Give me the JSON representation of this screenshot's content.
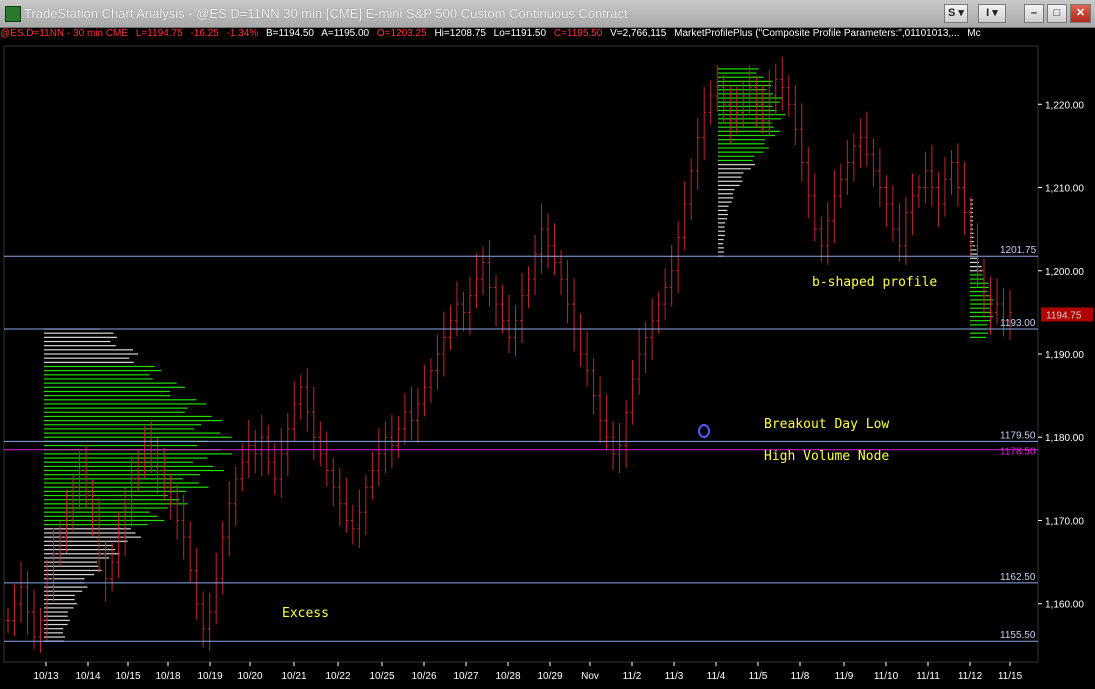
{
  "window": {
    "title": "TradeStation Chart Analysis - @ES.D=11NN 30 min [CME] E-mini S&P 500 Custom Continuous Contract",
    "buttons": {
      "symbol_link": "S",
      "indicator_link": "I",
      "minimize": "–",
      "maximize": "□",
      "close": "✕"
    }
  },
  "status_bar": {
    "symbol": "@ES.D=11NN - 30 min CME",
    "last": "L=1194.75",
    "change": "-16.25",
    "change_pct": "-1.34%",
    "bid": "B=1194.50",
    "ask": "A=1195.00",
    "open": "O=1203.25",
    "high": "Hi=1208.75",
    "low": "Lo=1191.50",
    "close": "C=1195.50",
    "volume": "V=2,766,115",
    "indicator": "MarketProfilePlus (\"Composite Profile Parameters:\",01101013,...",
    "more": "Mc"
  },
  "colors": {
    "bar": "#c0262e",
    "profile_green": "#22e000",
    "profile_white": "#d8d8d8",
    "level_line": "#8ea6e8",
    "hvn_line": "#e020e0",
    "annotation": "#ffff40",
    "axis_text": "#ffffff",
    "level_text": "#c4cff8",
    "last_price_box": "#b00000"
  },
  "chart_data": {
    "type": "ohlc",
    "x_tick_labels": [
      "10/13",
      "10/14",
      "10/15",
      "10/18",
      "10/19",
      "10/20",
      "10/21",
      "10/22",
      "10/25",
      "10/26",
      "10/27",
      "10/28",
      "10/29",
      "Nov",
      "11/2",
      "11/3",
      "11/4",
      "11/5",
      "11/8",
      "11/9",
      "11/10",
      "11/11",
      "11/12",
      "11/15"
    ],
    "y_tick_labels": [
      "1,220.00",
      "1,210.00",
      "1,200.00",
      "1,190.00",
      "1,180.00",
      "1,170.00",
      "1,160.00"
    ],
    "ylim": [
      1153,
      1227
    ],
    "horizontal_levels": [
      {
        "value": 1201.75,
        "label": "1201.75"
      },
      {
        "value": 1193.0,
        "label": "1193.00"
      },
      {
        "value": 1179.5,
        "label": "1179.50"
      },
      {
        "value": 1178.5,
        "label": "1178.50"
      },
      {
        "value": 1162.5,
        "label": "1162.50"
      },
      {
        "value": 1155.5,
        "label": "1155.50"
      }
    ],
    "last_price": {
      "value": 1194.75,
      "label": "1194.75"
    },
    "annotations": [
      {
        "text": "b-shaped profile"
      },
      {
        "text": "Breakout Day Low"
      },
      {
        "text": "High Volume Node"
      },
      {
        "text": "Excess"
      }
    ],
    "profiles": [
      {
        "name": "composite-profile-oct",
        "low": 1155.5,
        "high": 1193.0,
        "poc": 1179.0,
        "x_start_date": "10/13"
      },
      {
        "name": "composite-profile-nov",
        "low": 1201.75,
        "high": 1224.5,
        "poc": 1219.0,
        "x_start_date": "11/4"
      },
      {
        "name": "b-shaped-profile",
        "low": 1192.0,
        "high": 1208.5,
        "poc": 1195.5,
        "x_start_date": "11/12"
      }
    ],
    "closes": [
      1158,
      1160,
      1162,
      1159,
      1156,
      1158,
      1163,
      1166,
      1168,
      1171,
      1174,
      1176,
      1173,
      1170,
      1166,
      1163,
      1165,
      1168,
      1172,
      1175,
      1177,
      1179,
      1178,
      1176,
      1174,
      1172,
      1170,
      1168,
      1164,
      1160,
      1157,
      1159,
      1163,
      1168,
      1172,
      1175,
      1177,
      1179,
      1178,
      1180,
      1177,
      1175,
      1178,
      1181,
      1184,
      1186,
      1183,
      1180,
      1178,
      1176,
      1174,
      1172,
      1170,
      1169,
      1171,
      1174,
      1176,
      1178,
      1180,
      1179,
      1181,
      1183,
      1182,
      1184,
      1186,
      1188,
      1190,
      1192,
      1194,
      1196,
      1195,
      1197,
      1199,
      1201,
      1198,
      1196,
      1194,
      1192,
      1194,
      1197,
      1199,
      1202,
      1205,
      1203,
      1201,
      1199,
      1196,
      1193,
      1190,
      1188,
      1185,
      1182,
      1180,
      1178,
      1179,
      1183,
      1187,
      1190,
      1192,
      1194,
      1196,
      1198,
      1200,
      1204,
      1208,
      1212,
      1216,
      1219,
      1221,
      1222,
      1220,
      1218,
      1219,
      1221,
      1222,
      1220,
      1218,
      1221,
      1223,
      1222,
      1220,
      1217,
      1213,
      1209,
      1205,
      1203,
      1206,
      1209,
      1211,
      1213,
      1215,
      1216,
      1214,
      1212,
      1210,
      1208,
      1205,
      1203,
      1207,
      1209,
      1210,
      1212,
      1210,
      1208,
      1211,
      1213,
      1210,
      1207,
      1203,
      1200,
      1197,
      1195,
      1196,
      1194,
      1195
    ]
  }
}
